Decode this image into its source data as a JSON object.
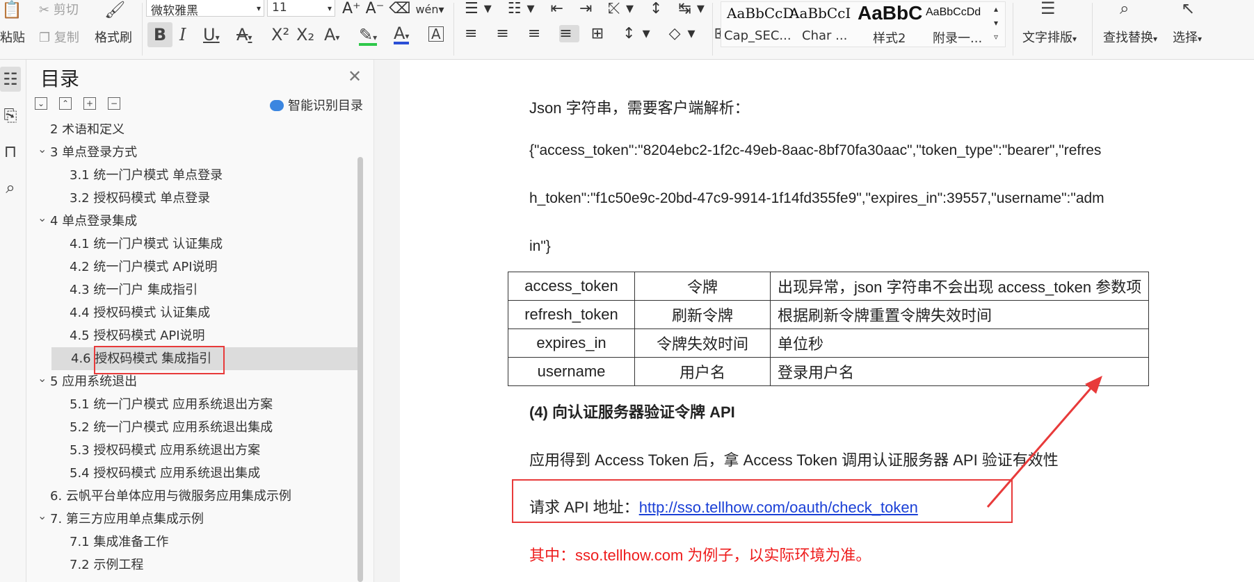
{
  "toolbar": {
    "paste_label": "粘贴",
    "cut_label": "剪切",
    "copy_label": "复制",
    "format_painter_label": "格式刷",
    "font_name": "微软雅黑",
    "font_size": "11",
    "text_layout_label": "文字排版",
    "find_replace_label": "查找替换",
    "select_label": "选择",
    "styles": [
      {
        "preview": "AaBbCcD",
        "name": "Cap_SEC..."
      },
      {
        "preview": "AaBbCcI",
        "name": "Char ..."
      },
      {
        "preview": "AaBbC",
        "name": "样式2"
      },
      {
        "preview": "AaBbCcDd",
        "name": "附录一..."
      }
    ]
  },
  "nav": {
    "title": "目录",
    "ai_label": "智能识别目录",
    "items": [
      {
        "text": "2  术语和定义",
        "level": 1,
        "arrow": ""
      },
      {
        "text": "3  单点登录方式",
        "level": 1,
        "arrow": "⌄"
      },
      {
        "text": "3.1  统一门户模式  单点登录",
        "level": 2,
        "arrow": ""
      },
      {
        "text": "3.2  授权码模式  单点登录",
        "level": 2,
        "arrow": ""
      },
      {
        "text": "4  单点登录集成",
        "level": 1,
        "arrow": "⌄"
      },
      {
        "text": "4.1  统一门户模式  认证集成",
        "level": 2,
        "arrow": ""
      },
      {
        "text": "4.2  统一门户模式  API说明",
        "level": 2,
        "arrow": ""
      },
      {
        "text": "4.3  统一门户  集成指引",
        "level": 2,
        "arrow": ""
      },
      {
        "text": "4.4  授权码模式  认证集成",
        "level": 2,
        "arrow": ""
      },
      {
        "text": "4.5  授权码模式  API说明",
        "level": 2,
        "arrow": ""
      },
      {
        "text": "4.6  授权码模式  集成指引",
        "level": 2,
        "arrow": "",
        "selected": true
      },
      {
        "text": "5    应用系统退出",
        "level": 1,
        "arrow": "⌄"
      },
      {
        "text": "5.1    统一门户模式  应用系统退出方案",
        "level": 2,
        "arrow": ""
      },
      {
        "text": "5.2  统一门户模式  应用系统退出集成",
        "level": 2,
        "arrow": ""
      },
      {
        "text": "5.3    授权码模式  应用系统退出方案",
        "level": 2,
        "arrow": ""
      },
      {
        "text": "5.4    授权码模式  应用系统退出集成",
        "level": 2,
        "arrow": ""
      },
      {
        "text": "6.  云帆平台单体应用与微服务应用集成示例",
        "level": 1,
        "arrow": ""
      },
      {
        "text": "7.  第三方应用单点集成示例",
        "level": 1,
        "arrow": "⌄"
      },
      {
        "text": "7.1  集成准备工作",
        "level": 2,
        "arrow": ""
      },
      {
        "text": "7.2  示例工程",
        "level": 2,
        "arrow": ""
      }
    ]
  },
  "doc": {
    "line1": "Json 字符串，需要客户端解析：",
    "json_line1": "{\"access_token\":\"8204ebc2-1f2c-49eb-8aac-8bf70fa30aac\",\"token_type\":\"bearer\",\"refres",
    "json_line2": "h_token\":\"f1c50e9c-20bd-47c9-9914-1f14fd355fe9\",\"expires_in\":39557,\"username\":\"adm",
    "json_line3": "in\"}",
    "table": [
      [
        "access_token",
        "令牌",
        "出现异常，json 字符串不会出现 access_token 参数项"
      ],
      [
        "refresh_token",
        "刷新令牌",
        "根据刷新令牌重置令牌失效时间"
      ],
      [
        "expires_in",
        "令牌失效时间",
        "单位秒"
      ],
      [
        "username",
        "用户名",
        "登录用户名"
      ]
    ],
    "heading": "(4) 向认证服务器验证令牌  API",
    "para": "应用得到 Access Token 后，拿 Access Token 调用认证服务器 API 验证有效性",
    "api_label": "请求 API 地址：",
    "api_url": "http://sso.tellhow.com/oauth/check_token",
    "note": "其中：sso.tellhow.com 为例子，以实际环境为准。"
  }
}
